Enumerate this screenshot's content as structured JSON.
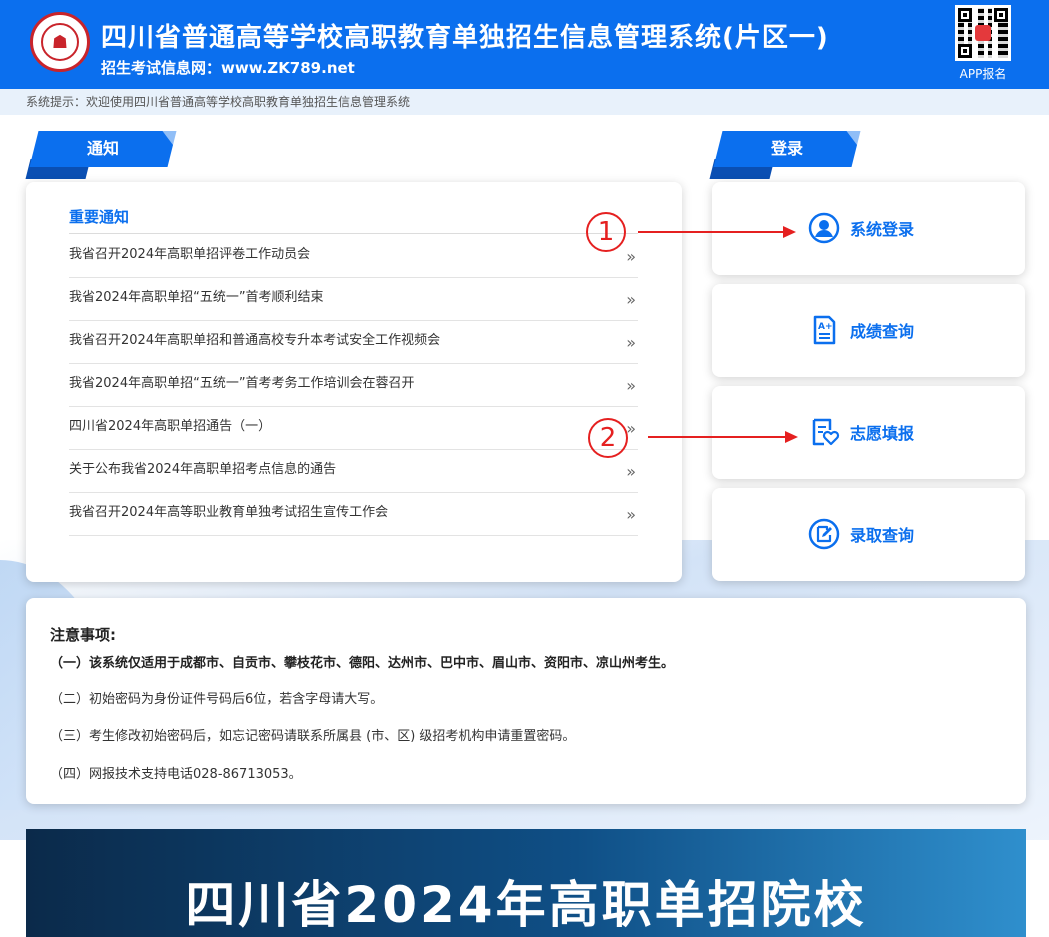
{
  "header": {
    "title": "四川省普通高等学校高职教育单独招生信息管理系统(片区一)",
    "subtitle": "招生考试信息网：www.ZK789.net",
    "app_label": "APP报名"
  },
  "system_tip": "系统提示：欢迎使用四川省普通高等学校高职教育单独招生信息管理系统",
  "notice_tab": "通知",
  "login_tab": "登录",
  "notices": {
    "heading": "重要通知",
    "items": [
      "我省召开2024年高职单招评卷工作动员会",
      "我省2024年高职单招“五统一”首考顺利结束",
      "我省召开2024年高职单招和普通高校专升本考试安全工作视频会",
      "我省2024年高职单招“五统一”首考考务工作培训会在蓉召开",
      "四川省2024年高职单招通告（一）",
      "关于公布我省2024年高职单招考点信息的通告",
      "我省召开2024年高等职业教育单独考试招生宣传工作会"
    ],
    "chevron": "»"
  },
  "login_buttons": [
    {
      "label": "系统登录",
      "icon": "user-icon"
    },
    {
      "label": "成绩查询",
      "icon": "score-sheet-icon"
    },
    {
      "label": "志愿填报",
      "icon": "volunteer-form-icon"
    },
    {
      "label": "录取查询",
      "icon": "edit-circle-icon"
    }
  ],
  "annotations": [
    "1",
    "2"
  ],
  "notes": {
    "title": "注意事项:",
    "lines": [
      "（一）该系统仅适用于成都市、自贡市、攀枝花市、德阳、达州市、巴中市、眉山市、资阳市、凉山州考生。",
      "（二）初始密码为身份证件号码后6位，若含字母请大写。",
      "（三）考生修改初始密码后，如忘记密码请联系所属县 (市、区) 级招考机构申请重置密码。",
      "（四）网报技术支持电话028-86713053。"
    ]
  },
  "banner": {
    "text": "四川省2024年高职单招院校"
  },
  "colors": {
    "primary": "#0b6fee",
    "annotation": "#e52020"
  }
}
